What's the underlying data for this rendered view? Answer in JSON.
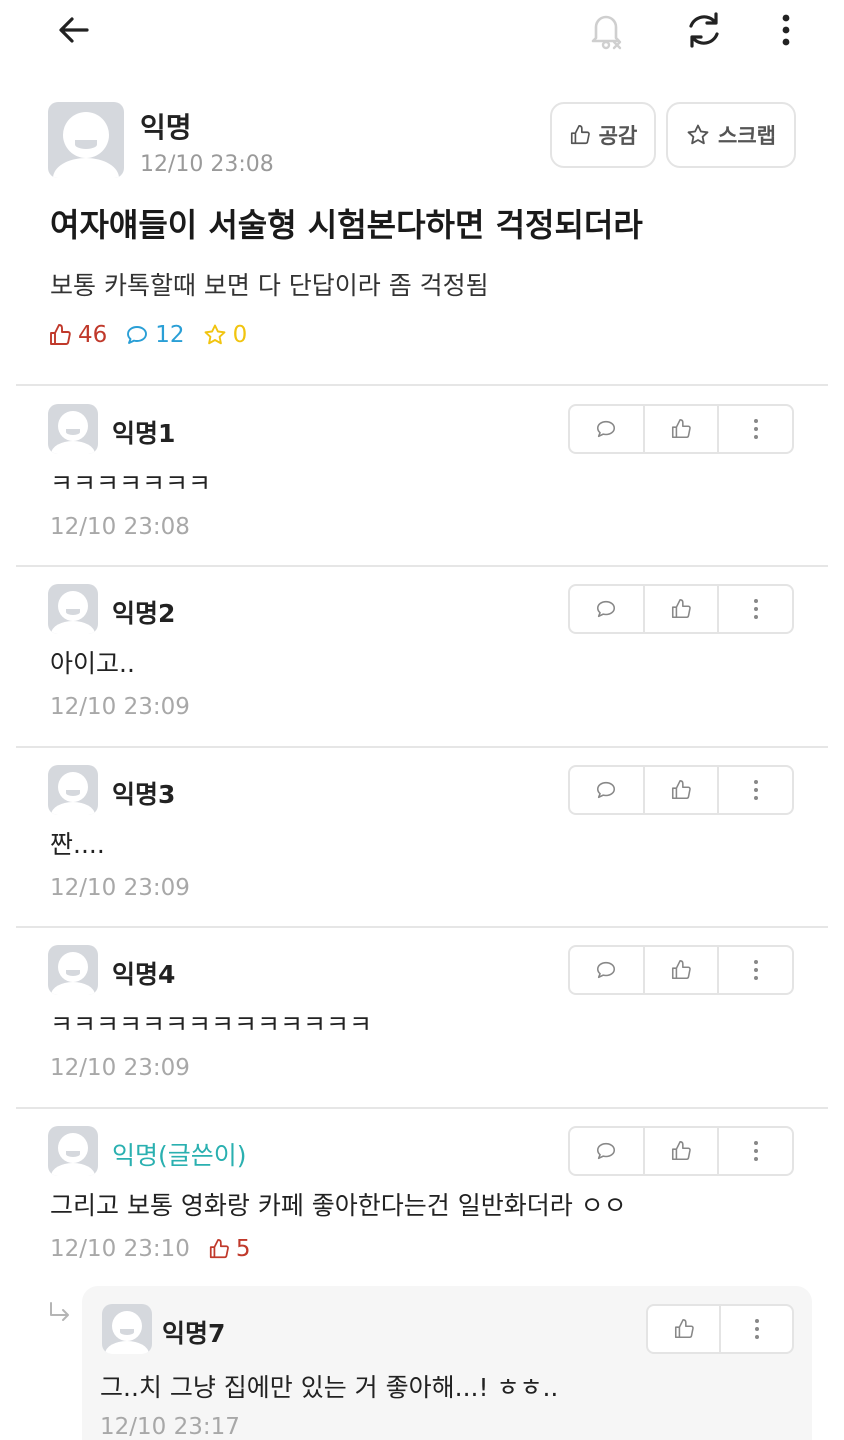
{
  "topbar": {
    "back_icon": "arrow-left-icon",
    "notification_icon": "bell-off-icon",
    "refresh_icon": "refresh-icon",
    "menu_icon": "kebab-menu-icon"
  },
  "post": {
    "author": "익명",
    "time": "12/10 23:08",
    "like_button_label": "공감",
    "scrap_button_label": "스크랩",
    "title": "여자얘들이 서술형 시험본다하면 걱정되더라",
    "body": "보통 카톡할때 보면 다 단답이라 좀 걱정됨",
    "stats": {
      "likes": "46",
      "comments": "12",
      "scraps": "0"
    }
  },
  "comments": [
    {
      "author": "익명1",
      "text": "ㅋㅋㅋㅋㅋㅋㅋ",
      "time": "12/10 23:08",
      "is_writer": false
    },
    {
      "author": "익명2",
      "text": "아이고..",
      "time": "12/10 23:09",
      "is_writer": false
    },
    {
      "author": "익명3",
      "text": "짠....",
      "time": "12/10 23:09",
      "is_writer": false
    },
    {
      "author": "익명4",
      "text": "ㅋㅋㅋㅋㅋㅋㅋㅋㅋㅋㅋㅋㅋㅋ",
      "time": "12/10 23:09",
      "is_writer": false
    },
    {
      "author": "익명(글쓴이)",
      "text": "그리고 보통 영화랑 카페 좋아한다는건 일반화더라 ㅇㅇ",
      "time": "12/10 23:10",
      "likes": "5",
      "is_writer": true
    }
  ],
  "reply": {
    "author": "익명7",
    "text": "그..치 그냥 집에만 있는 거 좋아해...! ㅎㅎ..",
    "time": "12/10 23:17"
  },
  "colors": {
    "like": "#c0392b",
    "comment": "#2a9fd6",
    "scrap": "#f1c40f",
    "writer": "#2ab0b0",
    "muted": "#a8a8a8"
  }
}
